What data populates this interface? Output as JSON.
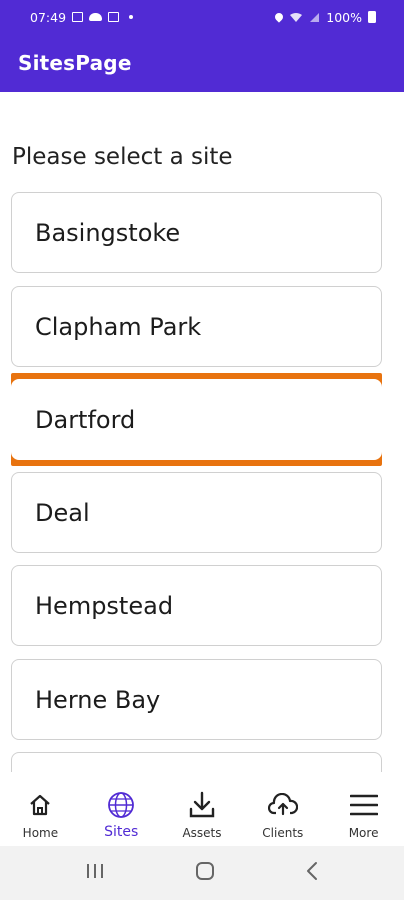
{
  "status_bar": {
    "time": "07:49",
    "battery": "100%"
  },
  "app_bar": {
    "title": "SitesPage"
  },
  "prompt": "Please select a site",
  "sites": [
    {
      "label": "Basingstoke",
      "selected": false
    },
    {
      "label": "Clapham Park",
      "selected": false
    },
    {
      "label": "Dartford",
      "selected": true
    },
    {
      "label": "Deal",
      "selected": false
    },
    {
      "label": "Hempstead",
      "selected": false
    },
    {
      "label": "Herne Bay",
      "selected": false
    }
  ],
  "tabs": [
    {
      "label": "Home",
      "icon": "home-icon",
      "active": false
    },
    {
      "label": "Sites",
      "icon": "globe-icon",
      "active": true
    },
    {
      "label": "Assets",
      "icon": "download-icon",
      "active": false
    },
    {
      "label": "Clients",
      "icon": "cloud-upload-icon",
      "active": false
    },
    {
      "label": "More",
      "icon": "menu-icon",
      "active": false
    }
  ],
  "colors": {
    "brand": "#512bd4",
    "selected_outline": "#e8730f",
    "tab_active": "#512bd4"
  }
}
